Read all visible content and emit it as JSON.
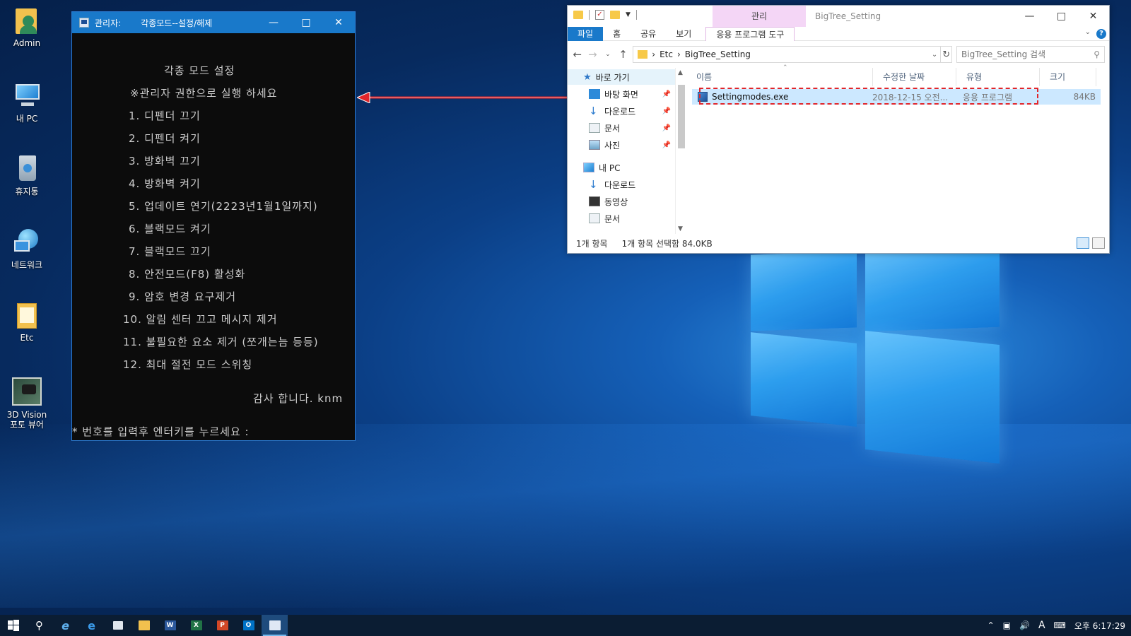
{
  "desktop": {
    "icons": [
      {
        "label": "Admin"
      },
      {
        "label": "내 PC"
      },
      {
        "label": "휴지통"
      },
      {
        "label": "네트워크"
      },
      {
        "label": "Etc"
      },
      {
        "label": "3D Vision\n포토 뷰어"
      }
    ]
  },
  "console": {
    "title_prefix": "관리자:",
    "title": "각종모드--설정/해제",
    "heading": "각종 모드 설정",
    "notice": "※관리자 권한으로 실행 하세요",
    "menu": [
      "1. 디펜더 끄기",
      "2. 디펜더 켜기",
      "3. 방화벽 끄기",
      "4. 방화벽 켜기",
      "5. 업데이트 연기(2223년1월1일까지)",
      "6. 블랙모드 켜기",
      "7. 블랙모드 끄기",
      "8. 안전모드(F8) 활성화",
      "9. 암호 변경 요구제거",
      "10. 알림 센터 끄고 메시지 제거",
      "11. 불필요한 요소 제거 (쪼개는늠 등등)",
      "12. 최대 절전 모드 스위칭"
    ],
    "thanks": "감사 합니다. knm",
    "prompt": "* 번호를 입력후 엔터키를 누르세요 :"
  },
  "explorer": {
    "title": "BigTree_Setting",
    "manage_tab": "관리",
    "ribbon_tabs": [
      "파일",
      "홈",
      "공유",
      "보기"
    ],
    "app_tools_tab": "응용 프로그램 도구",
    "breadcrumb": [
      "Etc",
      "BigTree_Setting"
    ],
    "search_placeholder": "BigTree_Setting 검색",
    "nav": {
      "quick_access": "바로 가기",
      "items": [
        "바탕 화면",
        "다운로드",
        "문서",
        "사진"
      ],
      "this_pc": "내 PC",
      "pc_items": [
        "다운로드",
        "동영상",
        "문서"
      ]
    },
    "columns": [
      "이름",
      "수정한 날짜",
      "유형",
      "크기"
    ],
    "files": [
      {
        "name": "Settingmodes.exe",
        "date": "2018-12-15 오전...",
        "type": "응용 프로그램",
        "size": "84KB"
      }
    ],
    "status": {
      "count": "1개 항목",
      "selected": "1개 항목 선택함 84.0KB"
    }
  },
  "taskbar": {
    "time": "오후 6:17:29",
    "ime": "A",
    "apps": [
      "start-icon",
      "search-icon",
      "ie-icon",
      "edge-icon",
      "store-icon",
      "file-explorer-icon",
      "word-icon",
      "excel-icon",
      "powerpoint-icon",
      "outlook-icon",
      "console-icon"
    ],
    "app_letters": {
      "word": "W",
      "excel": "X",
      "powerpoint": "P",
      "outlook": "O"
    }
  },
  "colors": {
    "accent": "#1979ca",
    "highlight": "#e0262b",
    "manage_tab": "#f4d6f6"
  }
}
